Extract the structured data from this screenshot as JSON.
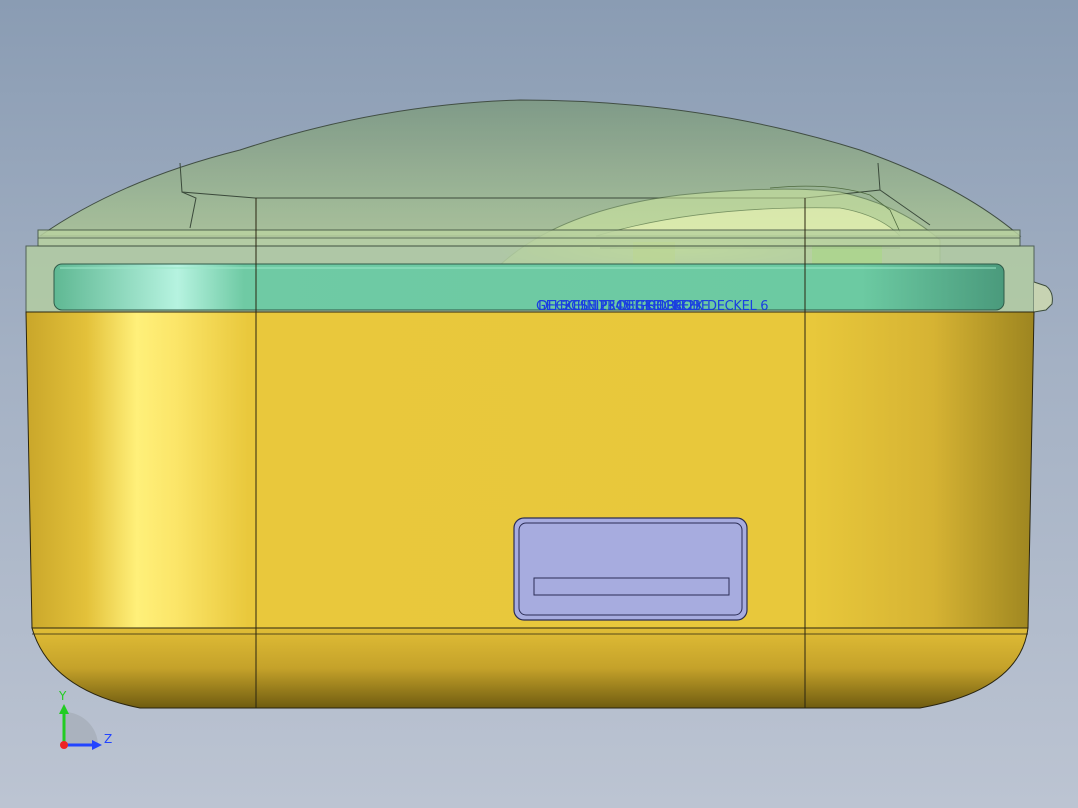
{
  "viewport": {
    "overlay_labels": [
      "GEH2CSE PROBE DECKEL",
      "DECKEL 12345 GEH PROBE",
      "SCHNITT DECKEL GEH",
      "PROBE 2X DECKEL 6"
    ]
  },
  "triad": {
    "y_label": "Y",
    "z_label": "Z",
    "colors": {
      "y": "#22cc22",
      "z": "#2244ff",
      "origin": "#ee2222"
    }
  },
  "colors": {
    "body": "#e8c83a",
    "lid": "#9fc79f",
    "band": "#6cc9a2",
    "label_plate": "#a7acdf"
  }
}
